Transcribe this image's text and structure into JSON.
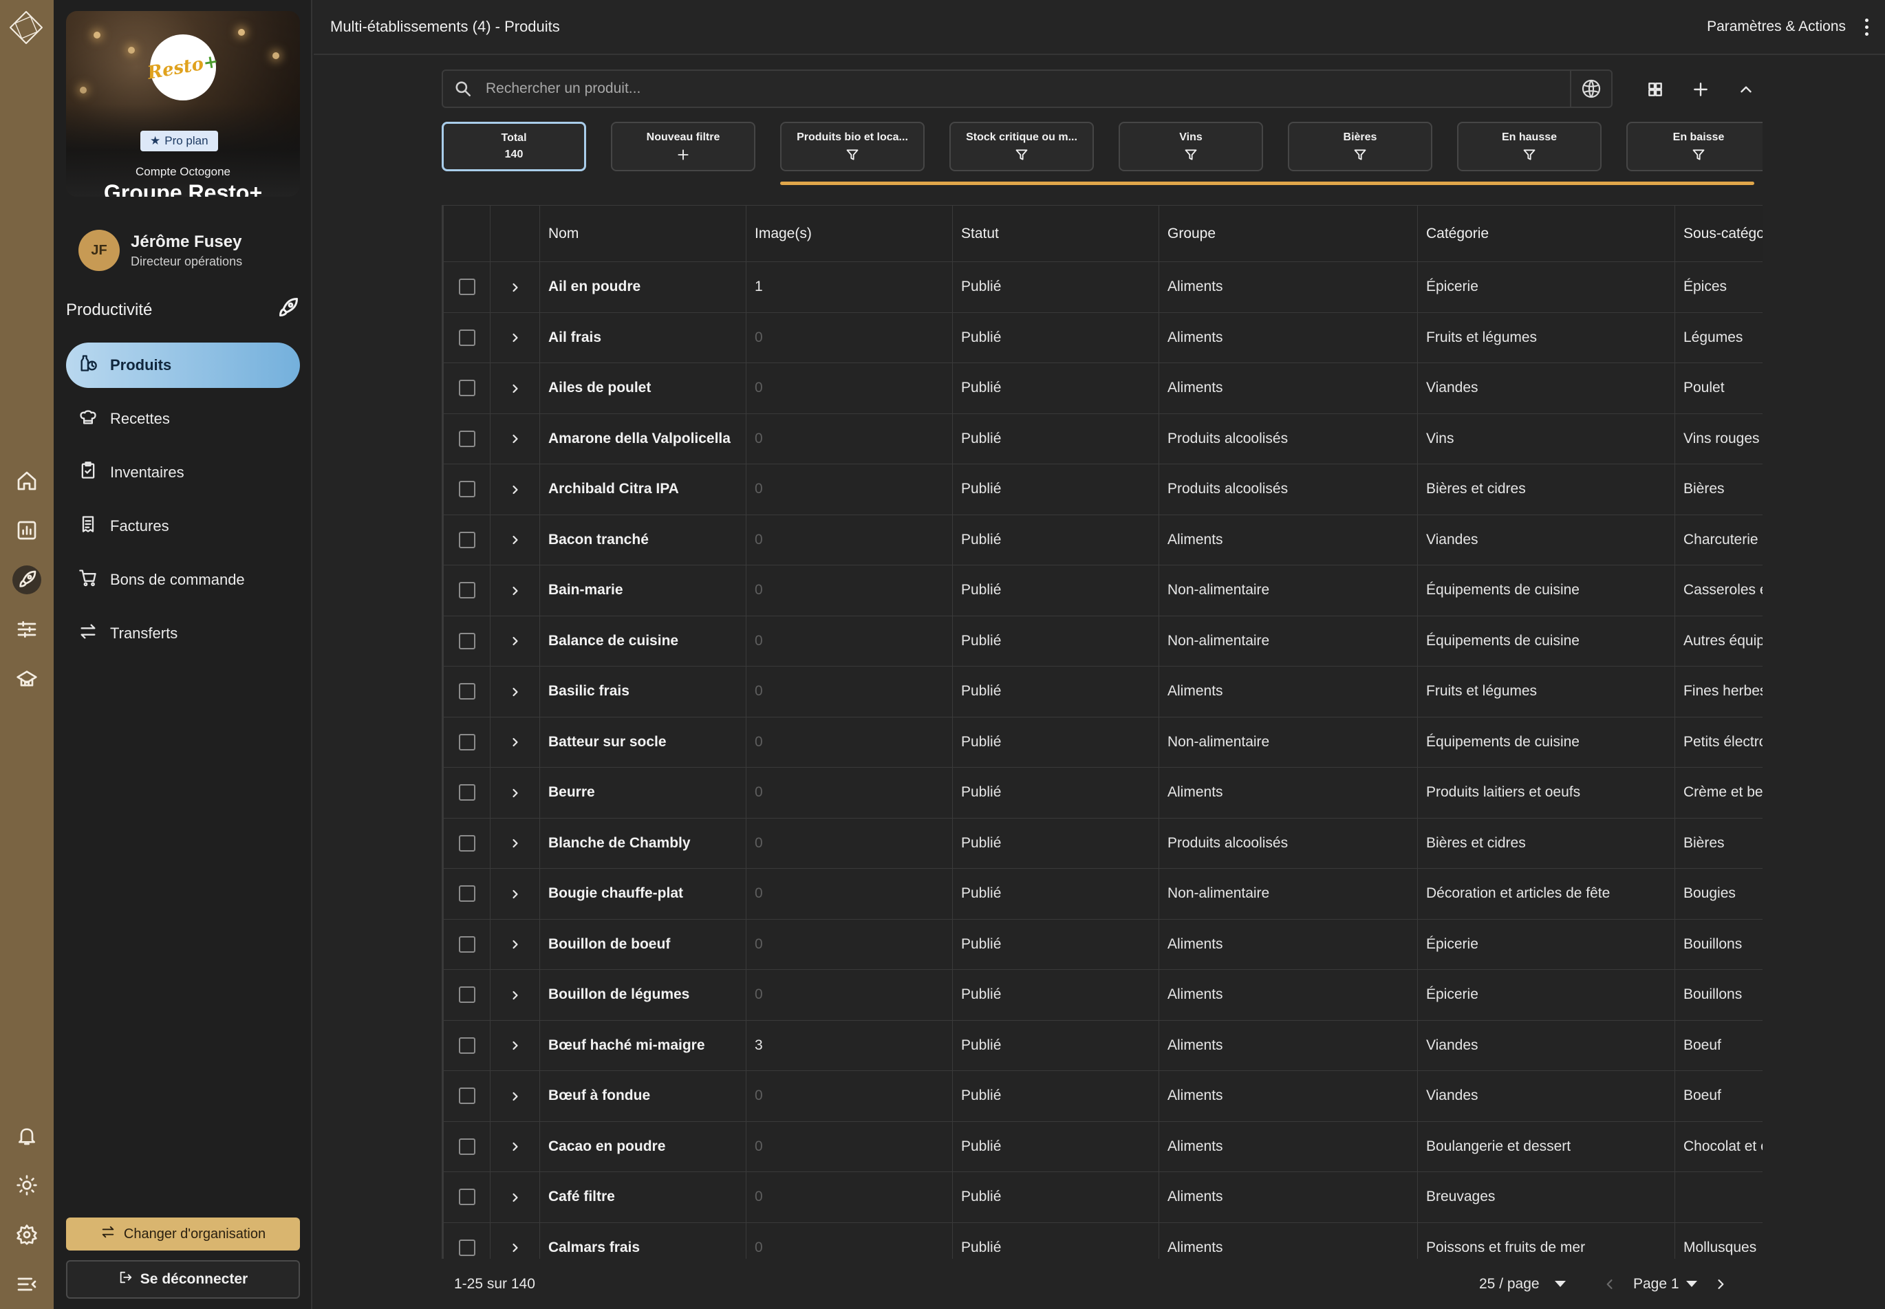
{
  "header": {
    "title": "Multi-établissements (4)  - Produits",
    "actions_label": "Paramètres & Actions"
  },
  "rail": {
    "icons": [
      "octogone-logo-icon",
      "home-icon",
      "chart-icon",
      "rocket-icon",
      "sliders-icon",
      "school-icon",
      "bell-icon",
      "sun-icon",
      "gear-icon",
      "menu-collapse-icon"
    ],
    "active": "rocket-icon"
  },
  "org": {
    "plan_badge": "Pro plan",
    "account_label": "Compte Octogone",
    "name": "Groupe Resto+",
    "logo_text_main": "Resto",
    "logo_text_plus": "+"
  },
  "user": {
    "initials": "JF",
    "name": "Jérôme Fusey",
    "role": "Directeur opérations"
  },
  "section": {
    "title": "Productivité"
  },
  "nav": [
    {
      "label": "Produits",
      "icon": "products-icon",
      "active": true
    },
    {
      "label": "Recettes",
      "icon": "chef-hat-icon",
      "active": false
    },
    {
      "label": "Inventaires",
      "icon": "clipboard-icon",
      "active": false
    },
    {
      "label": "Factures",
      "icon": "invoice-icon",
      "active": false
    },
    {
      "label": "Bons de commande",
      "icon": "cart-icon",
      "active": false
    },
    {
      "label": "Transferts",
      "icon": "transfer-icon",
      "active": false
    }
  ],
  "buttons": {
    "change_org": "Changer d'organisation",
    "logout": "Se déconnecter"
  },
  "search": {
    "placeholder": "Rechercher un produit..."
  },
  "filters": [
    {
      "label": "Total",
      "count": "140",
      "selected": true,
      "icon": "none"
    },
    {
      "label": "Nouveau filtre",
      "selected": false,
      "icon": "plus-icon"
    },
    {
      "label": "Produits bio et loca...",
      "selected": false,
      "icon": "filter-icon"
    },
    {
      "label": "Stock critique ou m...",
      "selected": false,
      "icon": "filter-icon"
    },
    {
      "label": "Vins",
      "selected": false,
      "icon": "filter-icon"
    },
    {
      "label": "Bières",
      "selected": false,
      "icon": "filter-icon"
    },
    {
      "label": "En hausse",
      "selected": false,
      "icon": "filter-icon"
    },
    {
      "label": "En baisse",
      "selected": false,
      "icon": "filter-icon"
    }
  ],
  "accent_color": "#e0a64a",
  "table": {
    "columns": [
      "Nom",
      "Image(s)",
      "Statut",
      "Groupe",
      "Catégorie",
      "Sous-catégorie"
    ],
    "rows": [
      [
        "Ail en poudre",
        "1",
        "Publié",
        "Aliments",
        "Épicerie",
        "Épices"
      ],
      [
        "Ail frais",
        "0",
        "Publié",
        "Aliments",
        "Fruits et légumes",
        "Légumes"
      ],
      [
        "Ailes de poulet",
        "0",
        "Publié",
        "Aliments",
        "Viandes",
        "Poulet"
      ],
      [
        "Amarone della Valpolicella",
        "0",
        "Publié",
        "Produits alcoolisés",
        "Vins",
        "Vins rouges"
      ],
      [
        "Archibald Citra IPA",
        "0",
        "Publié",
        "Produits alcoolisés",
        "Bières et cidres",
        "Bières"
      ],
      [
        "Bacon tranché",
        "0",
        "Publié",
        "Aliments",
        "Viandes",
        "Charcuterie"
      ],
      [
        "Bain-marie",
        "0",
        "Publié",
        "Non-alimentaire",
        "Équipements de cuisine",
        "Casseroles et"
      ],
      [
        "Balance de cuisine",
        "0",
        "Publié",
        "Non-alimentaire",
        "Équipements de cuisine",
        "Autres équip"
      ],
      [
        "Basilic frais",
        "0",
        "Publié",
        "Aliments",
        "Fruits et légumes",
        "Fines herbes"
      ],
      [
        "Batteur sur socle",
        "0",
        "Publié",
        "Non-alimentaire",
        "Équipements de cuisine",
        "Petits électro"
      ],
      [
        "Beurre",
        "0",
        "Publié",
        "Aliments",
        "Produits laitiers et oeufs",
        "Crème et beu"
      ],
      [
        "Blanche de Chambly",
        "0",
        "Publié",
        "Produits alcoolisés",
        "Bières et cidres",
        "Bières"
      ],
      [
        "Bougie chauffe-plat",
        "0",
        "Publié",
        "Non-alimentaire",
        "Décoration et articles de fête",
        "Bougies"
      ],
      [
        "Bouillon de boeuf",
        "0",
        "Publié",
        "Aliments",
        "Épicerie",
        "Bouillons"
      ],
      [
        "Bouillon de légumes",
        "0",
        "Publié",
        "Aliments",
        "Épicerie",
        "Bouillons"
      ],
      [
        "Bœuf haché mi-maigre",
        "3",
        "Publié",
        "Aliments",
        "Viandes",
        "Boeuf"
      ],
      [
        "Bœuf à fondue",
        "0",
        "Publié",
        "Aliments",
        "Viandes",
        "Boeuf"
      ],
      [
        "Cacao en poudre",
        "0",
        "Publié",
        "Aliments",
        "Boulangerie et dessert",
        "Chocolat et c"
      ],
      [
        "Café filtre",
        "0",
        "Publié",
        "Aliments",
        "Breuvages",
        ""
      ],
      [
        "Calmars frais",
        "0",
        "Publié",
        "Aliments",
        "Poissons et fruits de mer",
        "Mollusques"
      ]
    ]
  },
  "footer": {
    "range": "1-25 sur 140",
    "per_page": "25 / page",
    "page": "Page 1"
  }
}
